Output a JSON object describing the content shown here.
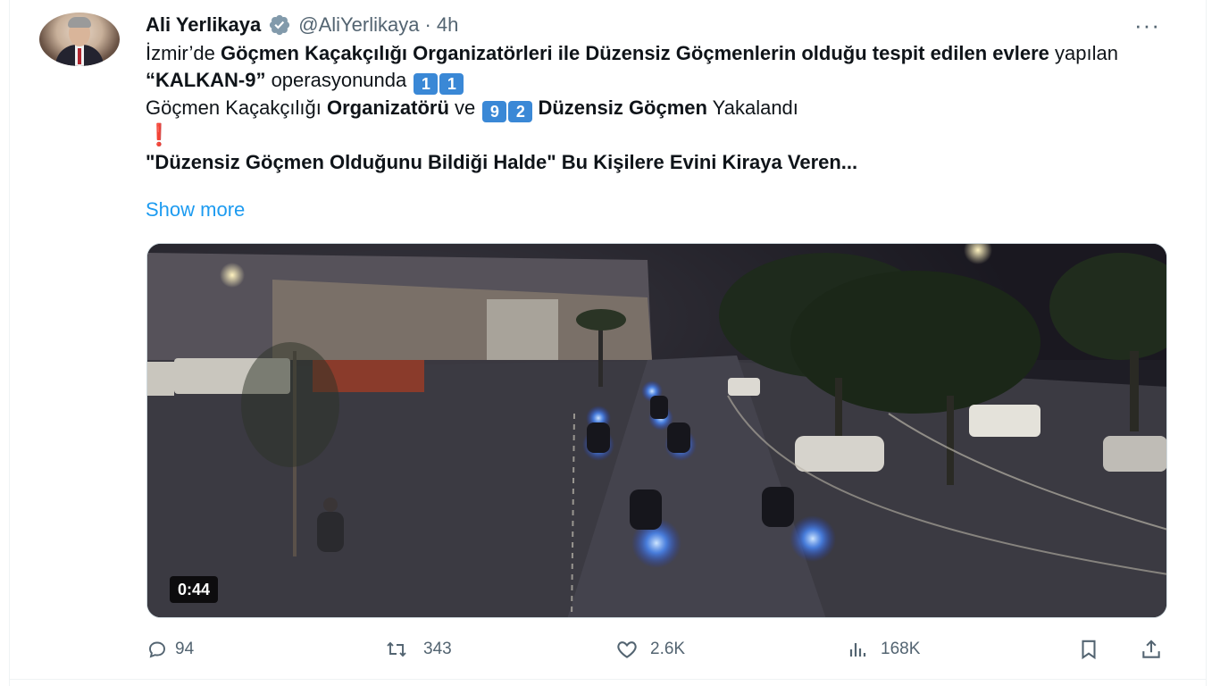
{
  "author": {
    "name": "Ali Yerlikaya",
    "handle": "@AliYerlikaya",
    "separator": "·",
    "time": "4h",
    "verified_color": "#829aab"
  },
  "more_label": "···",
  "tweet": {
    "p1a": "İzmir’de ",
    "p1b": "Göçmen Kaçakçılığı Organizatörleri ile Düzensiz Göçmenlerin olduğu tespit edilen evlere",
    "p1c": " yapılan ",
    "p1d": "“KALKAN-9”",
    "p1e": " operasyonunda ",
    "k1": "1",
    "k2": "1",
    "p1f": "Göçmen Kaçakçılığı ",
    "p1g": "Organizatörü",
    "p1h": " ve ",
    "k3": "9",
    "k4": "2",
    "p1i": "Düzensiz Göçmen",
    "p1j": " Yakalandı",
    "excl": "❗",
    "p2": "\"Düzensiz Göçmen Olduğunu Bildiği Halde\" Bu Kişilere Evini Kiraya Veren...",
    "show_more": "Show more",
    "keycap_color": "#3a88d6"
  },
  "media": {
    "duration": "0:44",
    "description_icon": "video-thumbnail"
  },
  "actions": {
    "replies": "94",
    "reposts": "343",
    "likes": "2.6K",
    "views": "168K"
  },
  "icons": {
    "reply": "reply-icon",
    "repost": "repost-icon",
    "like": "like-icon",
    "views": "views-icon",
    "bookmark": "bookmark-icon",
    "share": "share-icon"
  }
}
